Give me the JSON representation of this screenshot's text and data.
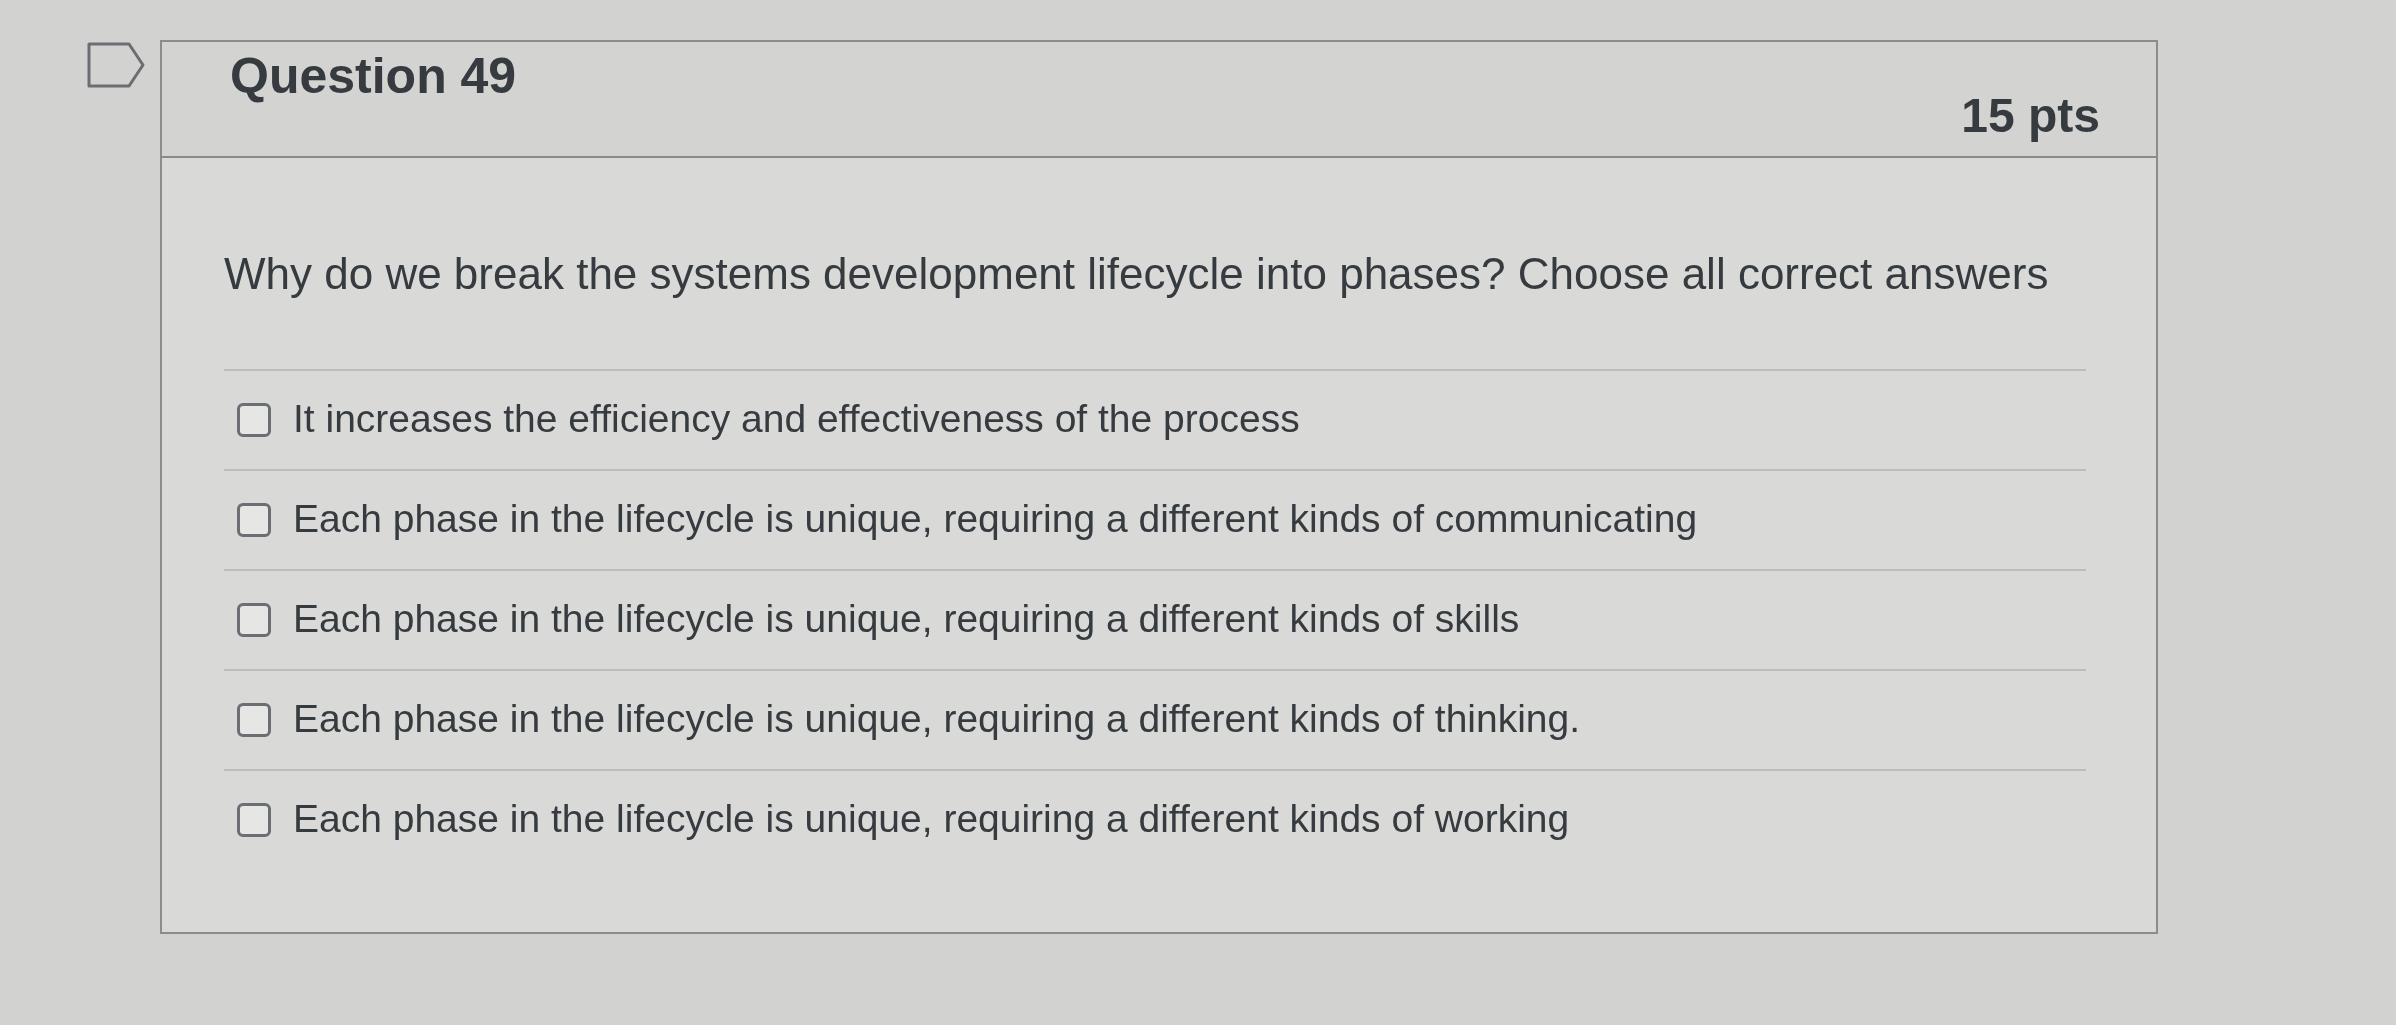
{
  "question": {
    "title": "Question 49",
    "points": "15 pts",
    "flagged": false,
    "prompt": "Why do we break the systems development lifecycle into phases? Choose all correct answers",
    "answers": [
      {
        "label": "It increases the efficiency and effectiveness of the process",
        "checked": false
      },
      {
        "label": "Each phase in the lifecycle is unique, requiring a different kinds of communicating",
        "checked": false
      },
      {
        "label": "Each phase in the lifecycle is unique, requiring a different kinds of skills",
        "checked": false
      },
      {
        "label": "Each phase in the lifecycle is unique, requiring a different kinds of thinking.",
        "checked": false
      },
      {
        "label": "Each phase in the lifecycle is unique, requiring a different kinds of working",
        "checked": false
      }
    ]
  }
}
